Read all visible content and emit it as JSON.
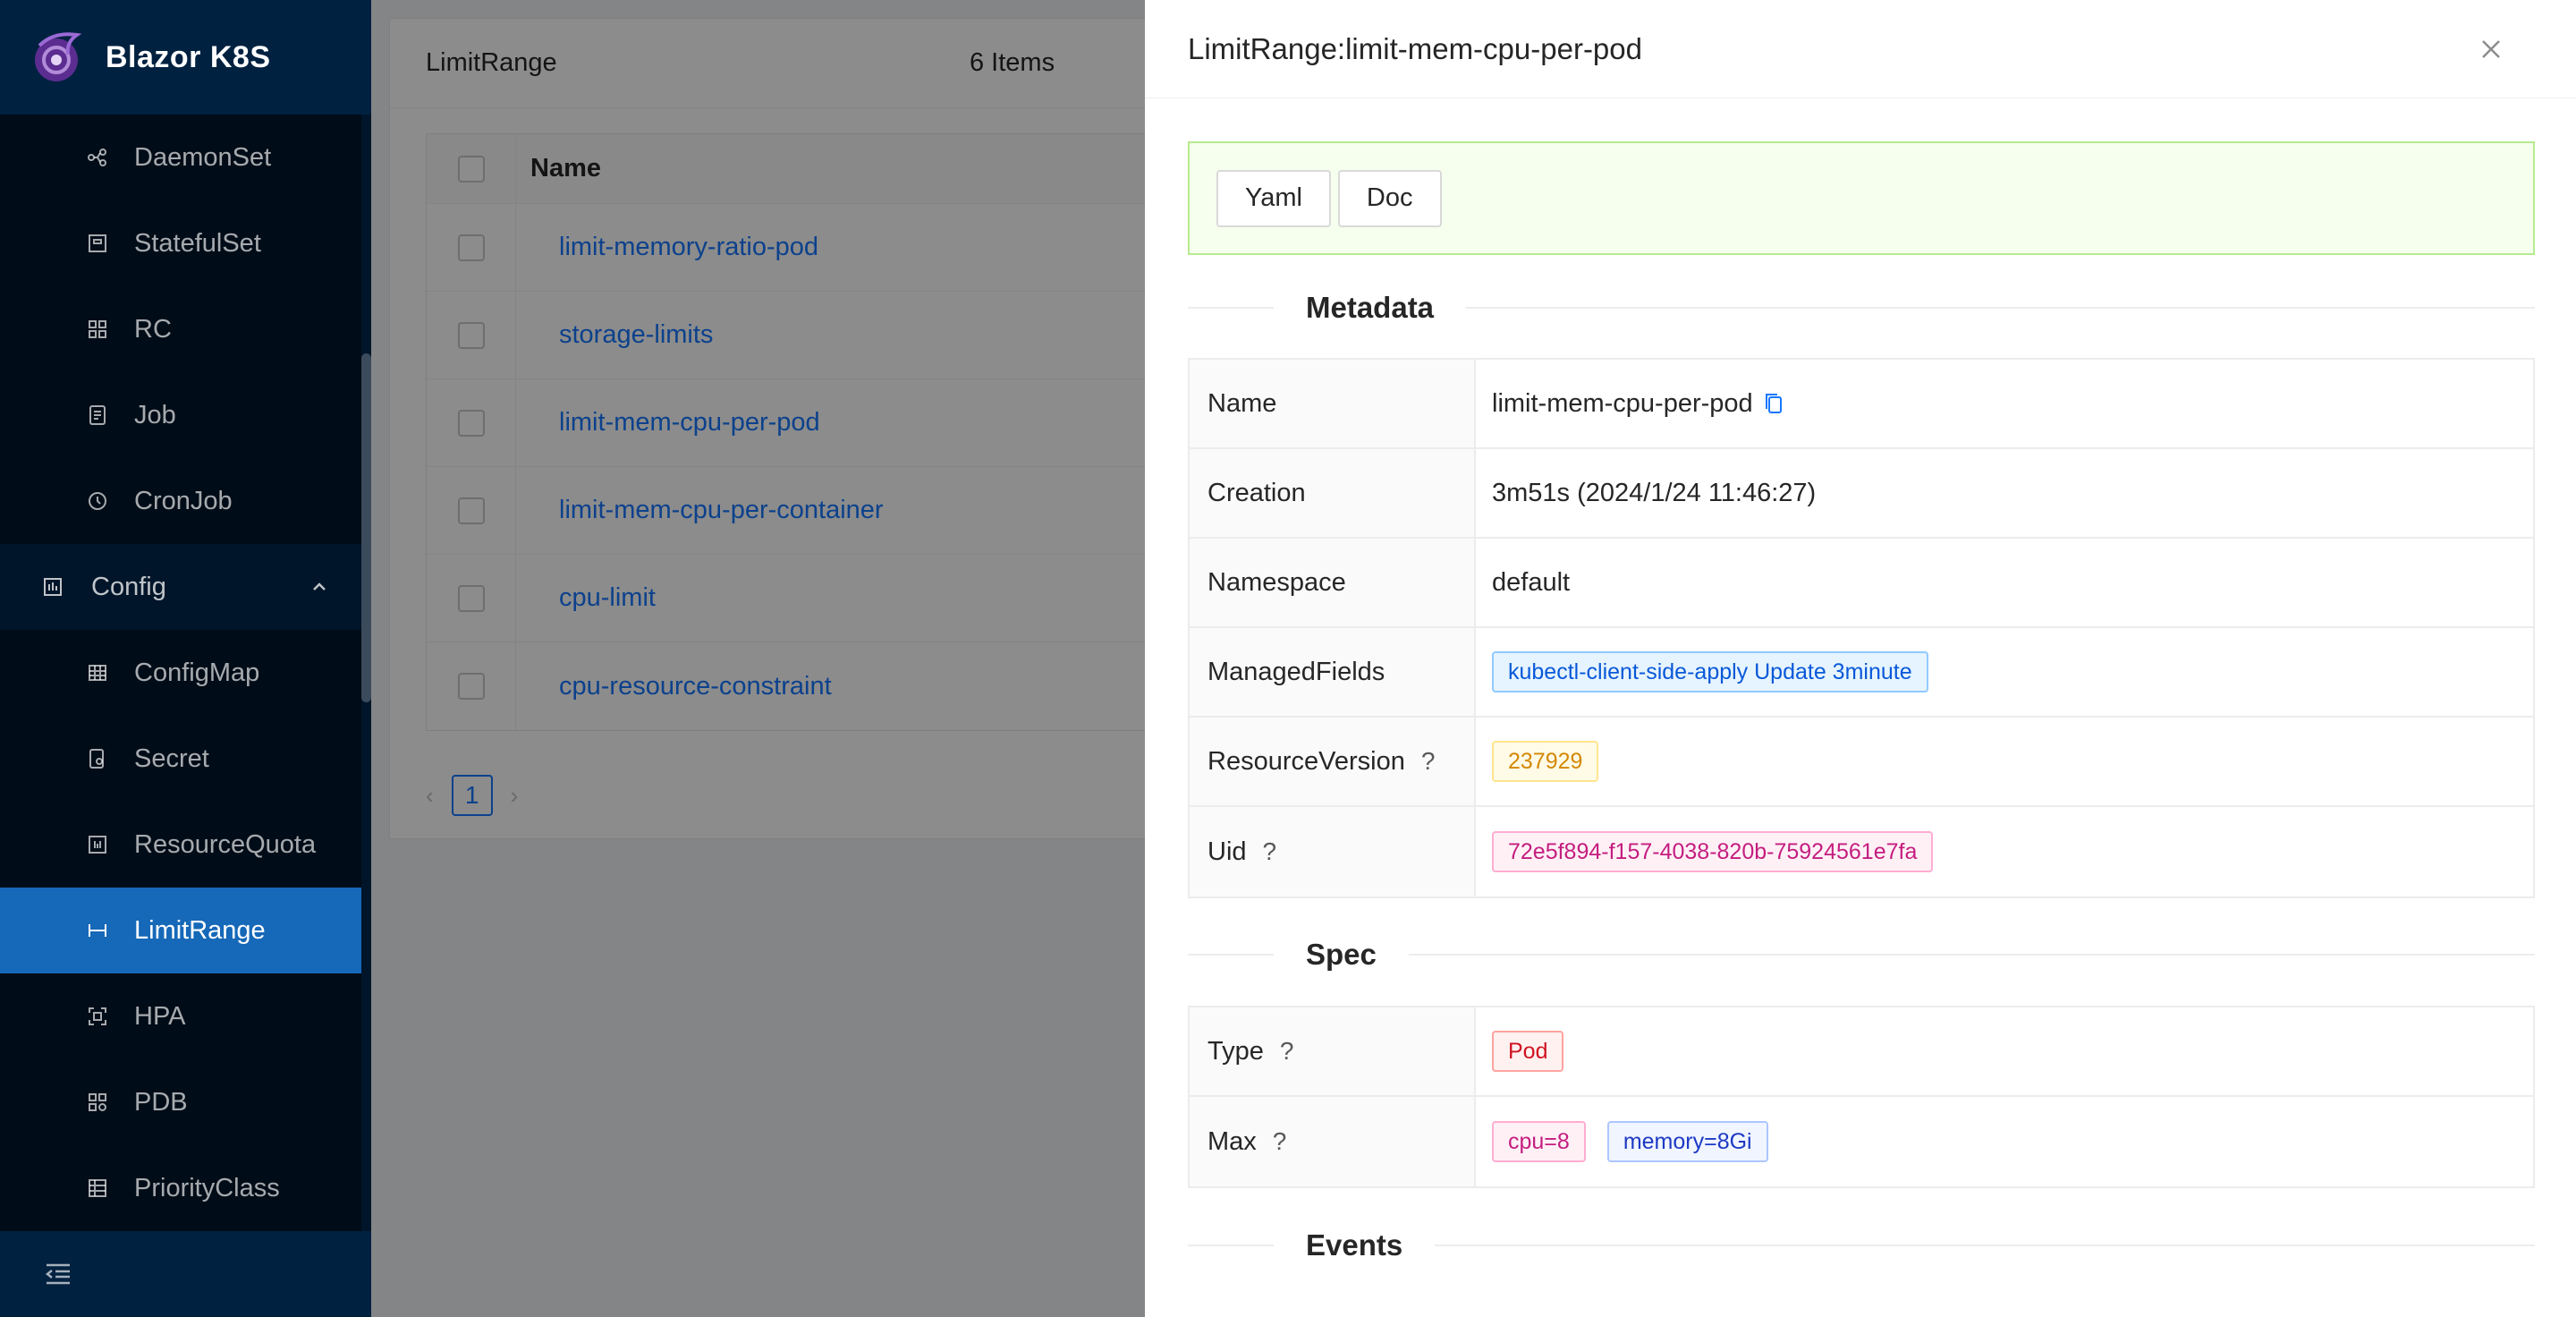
{
  "app": {
    "title": "Blazor K8S"
  },
  "sidebar": {
    "items": [
      {
        "label": "DaemonSet",
        "icon": "daemonset-icon",
        "type": "sub"
      },
      {
        "label": "StatefulSet",
        "icon": "statefulset-icon",
        "type": "sub"
      },
      {
        "label": "RC",
        "icon": "rc-icon",
        "type": "sub"
      },
      {
        "label": "Job",
        "icon": "job-icon",
        "type": "sub"
      },
      {
        "label": "CronJob",
        "icon": "cronjob-icon",
        "type": "sub"
      },
      {
        "label": "Config",
        "icon": "config-icon",
        "type": "group"
      },
      {
        "label": "ConfigMap",
        "icon": "configmap-icon",
        "type": "sub"
      },
      {
        "label": "Secret",
        "icon": "secret-icon",
        "type": "sub"
      },
      {
        "label": "ResourceQuota",
        "icon": "resourcequota-icon",
        "type": "sub"
      },
      {
        "label": "LimitRange",
        "icon": "limitrange-icon",
        "type": "sub",
        "active": true
      },
      {
        "label": "HPA",
        "icon": "hpa-icon",
        "type": "sub"
      },
      {
        "label": "PDB",
        "icon": "pdb-icon",
        "type": "sub"
      },
      {
        "label": "PriorityClass",
        "icon": "priorityclass-icon",
        "type": "sub"
      }
    ]
  },
  "list": {
    "title": "LimitRange",
    "count": "6 Items",
    "column_name": "Name",
    "rows": [
      "limit-memory-ratio-pod",
      "storage-limits",
      "limit-mem-cpu-per-pod",
      "limit-mem-cpu-per-container",
      "cpu-limit",
      "cpu-resource-constraint"
    ],
    "page": "1"
  },
  "drawer": {
    "title": "LimitRange:limit-mem-cpu-per-pod",
    "buttons": {
      "yaml": "Yaml",
      "doc": "Doc"
    },
    "sections": {
      "metadata": "Metadata",
      "spec": "Spec",
      "events": "Events"
    },
    "metadata": {
      "name_label": "Name",
      "name_value": "limit-mem-cpu-per-pod",
      "creation_label": "Creation",
      "creation_value": "3m51s (2024/1/24 11:46:27)",
      "namespace_label": "Namespace",
      "namespace_value": "default",
      "managed_label": "ManagedFields",
      "managed_value": "kubectl-client-side-apply Update 3minute",
      "rv_label": "ResourceVersion",
      "rv_value": "237929",
      "uid_label": "Uid",
      "uid_value": "72e5f894-f157-4038-820b-75924561e7fa",
      "help_glyph": "?"
    },
    "spec": {
      "type_label": "Type",
      "type_value": "Pod",
      "max_label": "Max",
      "max_cpu": "cpu=8",
      "max_memory": "memory=8Gi"
    }
  },
  "colors": {
    "accent": "#1677ff",
    "sidebar_bg": "#001529",
    "active_bg": "#1668b8"
  }
}
